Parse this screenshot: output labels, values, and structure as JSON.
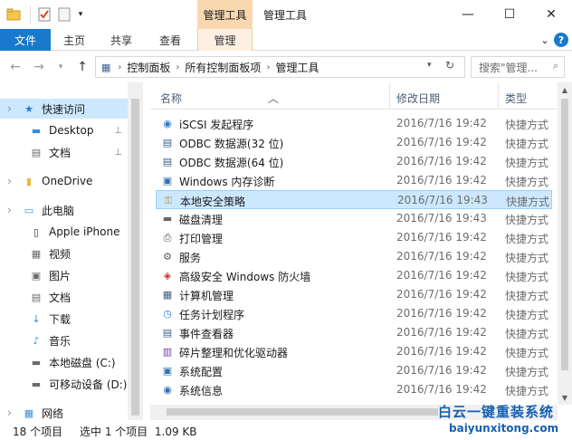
{
  "window": {
    "title": "管理工具",
    "context_tab": "管理工具",
    "controls": {
      "minimize": "—",
      "maximize": "☐",
      "close": "✕"
    }
  },
  "ribbon": {
    "file": "文件",
    "tabs": [
      "主页",
      "共享",
      "查看",
      "管理"
    ],
    "active_tab": "管理",
    "expand_icon": "⌄",
    "help_icon": "?"
  },
  "address": {
    "crumbs": [
      "控制面板",
      "所有控制面板项",
      "管理工具"
    ],
    "refresh_icon": "↻",
    "search_placeholder": "搜索\"管理...",
    "search_icon": "🔍"
  },
  "nav": {
    "items": [
      {
        "label": "快速访问",
        "icon": "★",
        "color": "#2a7ad8",
        "pinned": false,
        "level": 0
      },
      {
        "label": "Desktop",
        "icon": "▬",
        "color": "#2f8fe0",
        "pinned": true,
        "level": 1
      },
      {
        "label": "文档",
        "icon": "▤",
        "color": "#6b6b6b",
        "pinned": true,
        "level": 1
      },
      {
        "label": "OneDrive",
        "icon": "▮",
        "color": "#e8b93f",
        "pinned": false,
        "level": 0
      },
      {
        "label": "此电脑",
        "icon": "▭",
        "color": "#3b8ed8",
        "pinned": false,
        "level": 0
      },
      {
        "label": "Apple iPhone",
        "icon": "▯",
        "color": "#333333",
        "pinned": false,
        "level": 1
      },
      {
        "label": "视频",
        "icon": "▦",
        "color": "#6b6b6b",
        "pinned": false,
        "level": 1
      },
      {
        "label": "图片",
        "icon": "▣",
        "color": "#6b6b6b",
        "pinned": false,
        "level": 1
      },
      {
        "label": "文档",
        "icon": "▤",
        "color": "#6b6b6b",
        "pinned": false,
        "level": 1
      },
      {
        "label": "下载",
        "icon": "↓",
        "color": "#2f8fe0",
        "pinned": false,
        "level": 1
      },
      {
        "label": "音乐",
        "icon": "♪",
        "color": "#2f8fe0",
        "pinned": false,
        "level": 1
      },
      {
        "label": "本地磁盘 (C:)",
        "icon": "▬",
        "color": "#6b6b6b",
        "pinned": false,
        "level": 1
      },
      {
        "label": "可移动设备 (D:)",
        "icon": "▬",
        "color": "#6b6b6b",
        "pinned": false,
        "level": 1
      },
      {
        "label": "网络",
        "icon": "▦",
        "color": "#3b8ed8",
        "pinned": false,
        "level": 0
      }
    ],
    "pin_icon": "📌"
  },
  "columns": {
    "name": "名称",
    "modified": "修改日期",
    "type": "类型"
  },
  "files": [
    {
      "name": "iSCSI 发起程序",
      "date": "2016/7/16 19:42",
      "type": "快捷方式",
      "icon": "◉",
      "color": "#2f7ad0"
    },
    {
      "name": "ODBC 数据源(32 位)",
      "date": "2016/7/16 19:42",
      "type": "快捷方式",
      "icon": "▤",
      "color": "#3d5f8c"
    },
    {
      "name": "ODBC 数据源(64 位)",
      "date": "2016/7/16 19:42",
      "type": "快捷方式",
      "icon": "▤",
      "color": "#3d5f8c"
    },
    {
      "name": "Windows 内存诊断",
      "date": "2016/7/16 19:42",
      "type": "快捷方式",
      "icon": "▣",
      "color": "#2f6fb0"
    },
    {
      "name": "本地安全策略",
      "date": "2016/7/16 19:43",
      "type": "快捷方式",
      "icon": "⚿",
      "color": "#b58a2a"
    },
    {
      "name": "磁盘清理",
      "date": "2016/7/16 19:43",
      "type": "快捷方式",
      "icon": "▬",
      "color": "#666666"
    },
    {
      "name": "打印管理",
      "date": "2016/7/16 19:42",
      "type": "快捷方式",
      "icon": "⎙",
      "color": "#555555"
    },
    {
      "name": "服务",
      "date": "2016/7/16 19:42",
      "type": "快捷方式",
      "icon": "⚙",
      "color": "#5a5a5a"
    },
    {
      "name": "高级安全 Windows 防火墙",
      "date": "2016/7/16 19:42",
      "type": "快捷方式",
      "icon": "◈",
      "color": "#c0392b"
    },
    {
      "name": "计算机管理",
      "date": "2016/7/16 19:42",
      "type": "快捷方式",
      "icon": "▦",
      "color": "#3d5f8c"
    },
    {
      "name": "任务计划程序",
      "date": "2016/7/16 19:42",
      "type": "快捷方式",
      "icon": "◷",
      "color": "#2f7ad0"
    },
    {
      "name": "事件查看器",
      "date": "2016/7/16 19:42",
      "type": "快捷方式",
      "icon": "▤",
      "color": "#3d5f8c"
    },
    {
      "name": "碎片整理和优化驱动器",
      "date": "2016/7/16 19:42",
      "type": "快捷方式",
      "icon": "▥",
      "color": "#6f3fa8"
    },
    {
      "name": "系统配置",
      "date": "2016/7/16 19:42",
      "type": "快捷方式",
      "icon": "▣",
      "color": "#2f6fb0"
    },
    {
      "name": "系统信息",
      "date": "2016/7/16 19:42",
      "type": "快捷方式",
      "icon": "◉",
      "color": "#2f6fb0"
    }
  ],
  "selected_file": "本地安全策略",
  "status": {
    "count": "18 个项目",
    "selection": "选中 1 个项目  1.09 KB"
  },
  "watermark": {
    "line1": "白云一键重装系统",
    "line2": "baiyunxitong.com"
  }
}
